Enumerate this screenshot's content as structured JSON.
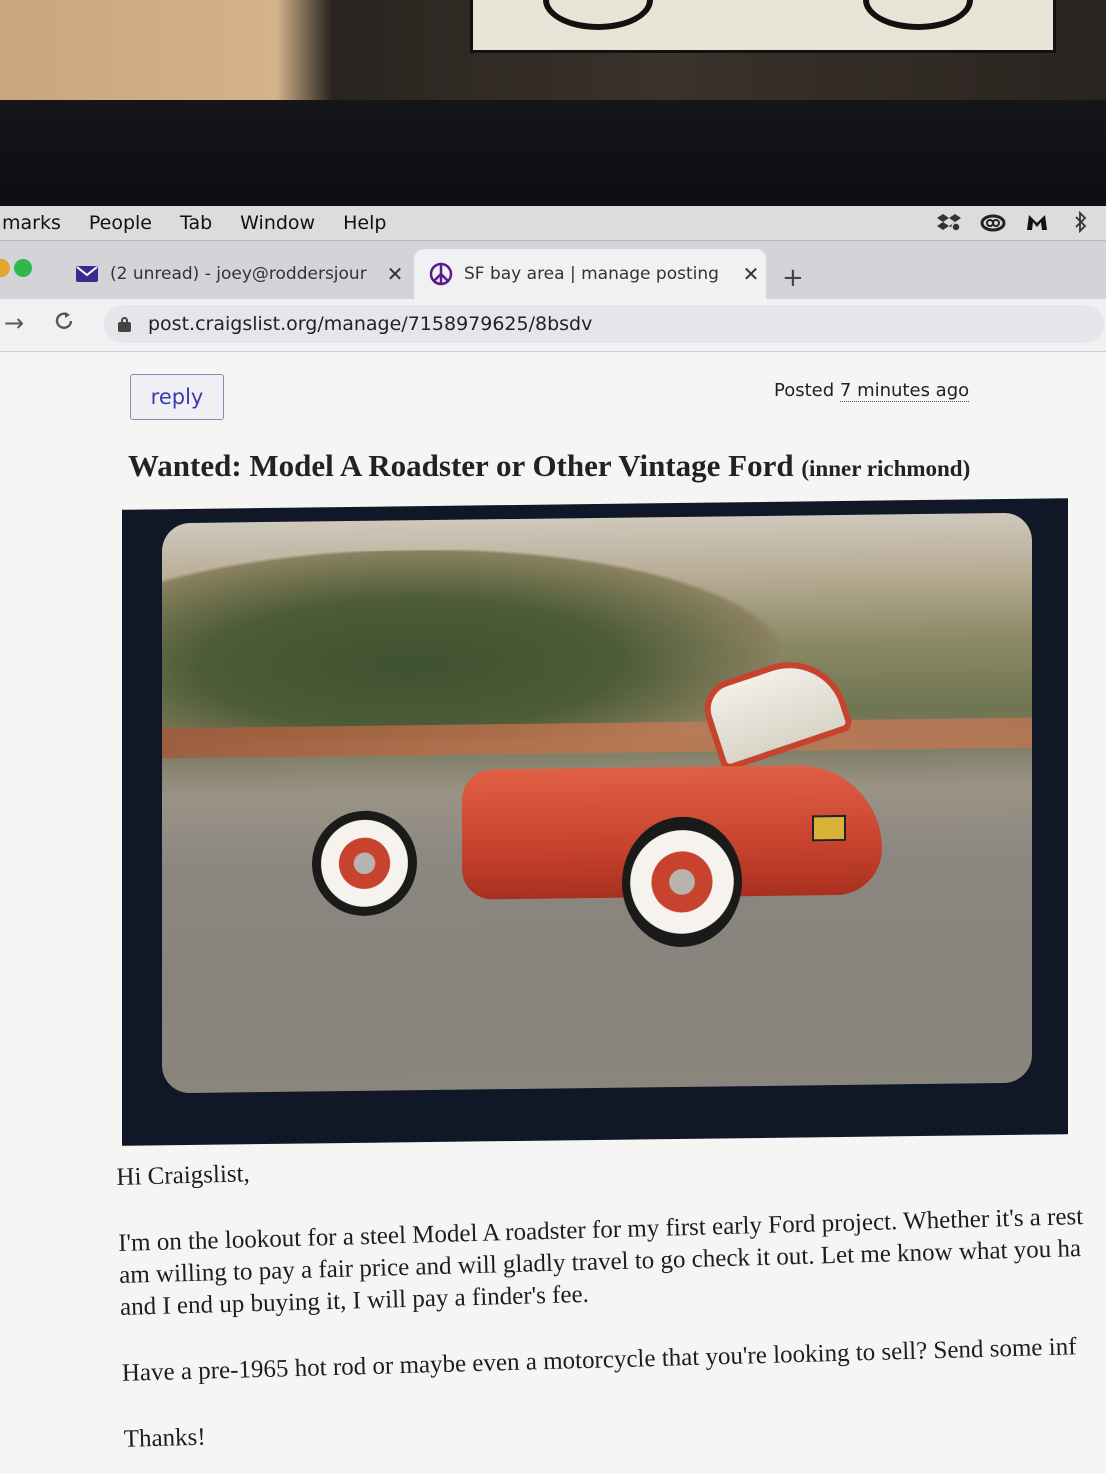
{
  "menubar": {
    "items": [
      "marks",
      "People",
      "Tab",
      "Window",
      "Help"
    ],
    "status_icons": [
      "dropbox-icon",
      "creative-cloud-icon",
      "malwarebytes-icon",
      "bluetooth-icon"
    ]
  },
  "tabs": [
    {
      "title": "(2 unread) - joey@roddersjour",
      "icon": "mail-icon",
      "active": false
    },
    {
      "title": "SF bay area | manage posting",
      "icon": "peace-icon",
      "active": true
    }
  ],
  "toolbar": {
    "url": "post.craigslist.org/manage/7158979625/8bsdv"
  },
  "posting": {
    "reply_label": "reply",
    "posted_prefix": "Posted",
    "posted_ago": "7 minutes ago",
    "title": "Wanted: Model A Roadster or Other Vintage Ford",
    "location": "(inner richmond)",
    "body": {
      "greeting": "Hi Craigslist,",
      "para1_line1": "I'm on the lookout for a steel Model A roadster for my first early Ford project. Whether it's a rest",
      "para1_line2": "am willing to pay a fair price and will gladly travel to go check it out. Let me know what you ha",
      "para1_line3": "and I end up buying it, I will pay a finder's fee.",
      "para2": "Have a pre-1965 hot rod or maybe even a motorcycle that you're looking to sell? Send some inf",
      "closing": "Thanks!"
    }
  },
  "colors": {
    "link": "#3a3ab0",
    "tab_bg": "#d4d4d8",
    "page_bg": "#f5f5f3",
    "traffic_green": "#2fb84a",
    "traffic_yellow": "#e2a72a"
  }
}
